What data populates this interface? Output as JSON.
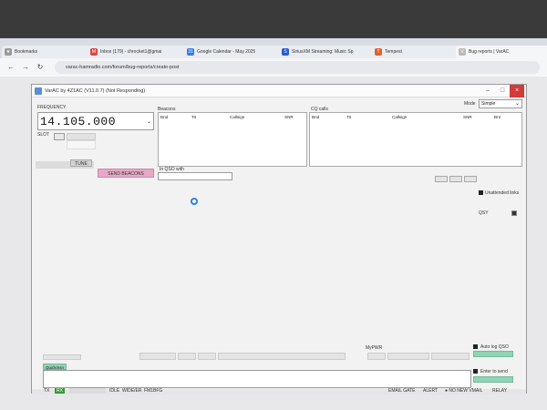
{
  "browser": {
    "tabs": [
      {
        "label": "Bookmarks",
        "icon": "bookmark-icon"
      },
      {
        "label": "Inbox (179) - chrocket1@gmai",
        "icon": "gmail-icon"
      },
      {
        "label": "Google Calendar - May 2025",
        "icon": "calendar-icon"
      },
      {
        "label": "SiriusXM Streaming: Music Sp",
        "icon": "siriusxm-icon"
      },
      {
        "label": "Tempest",
        "icon": "tempest-icon"
      },
      {
        "label": "Bug reports | VarAC",
        "icon": "varac-icon"
      }
    ],
    "url": "varac-hamradio.com/forum/bug-reports/create-post"
  },
  "app": {
    "title": "VarAC by 4Z1AC (V11.0.7) (Not Responding)",
    "frequency_label": "FREQUENCY",
    "frequency_value": "14.105.000",
    "slot_label": "SLOT",
    "tune_label": "TUNE",
    "send_beacons_label": "SEND BEACONS",
    "beacons_label": "Beacons",
    "beacons_columns": [
      "Bnd",
      "Tit",
      "Callsign",
      "SNR"
    ],
    "cq_label": "CQ calls",
    "cq_columns": [
      "Bnd",
      "Tit",
      "Callsign",
      "SNR",
      "Bnt"
    ],
    "mode_label": "Mode",
    "mode_value": "Simple",
    "in_qso_label": "In QSO with",
    "unattended_label": "Unattended links",
    "qsy_label": "QSY",
    "mypwr_label": "MyPWR",
    "autolog_label": "Auto log QSO",
    "enter_send_label": "Enter to send",
    "shortcuts_label": "Quickmsn Txtgs",
    "status": {
      "tx": "TX",
      "rx": "RX",
      "idle": "IDLE",
      "wide": "WIDE/ER",
      "fm": "FM1BFG",
      "email_gate": "EMAIL GATE",
      "alert": "ALERT",
      "no_new_vmail": "NO NEW VMAIL",
      "relay": "RELAY"
    }
  }
}
